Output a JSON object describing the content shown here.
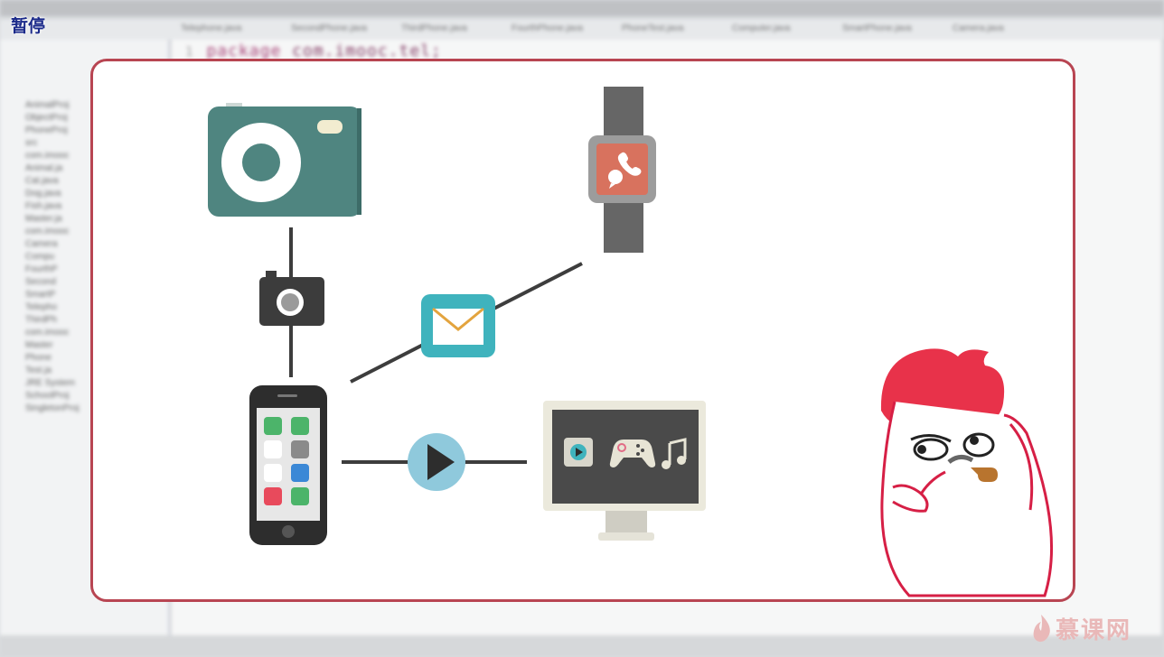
{
  "overlay": {
    "status": "暂停"
  },
  "ide": {
    "editor_tabs": [
      "Telephone.java",
      "SecondPhone.java",
      "ThirdPhone.java",
      "FourthPhone.java",
      "PhoneTest.java",
      "Computer.java",
      "SmartPhone.java",
      "Camera.java"
    ],
    "code_line_number": "1",
    "code_keyword": "package",
    "code_text": "com.imooc.tel;",
    "tree_items": [
      "AnimalProj",
      "ObjectProj",
      "PhoneProj",
      "src",
      "com.imooc",
      "Animal.ja",
      "Cat.java",
      "Dog.java",
      "Fish.java",
      "Master.ja",
      "com.imooc",
      "Camera",
      "Compu",
      "FourthP",
      "Second",
      "SmartP",
      "Telepho",
      "ThirdPh",
      "com.imooc",
      "Master",
      "Phone",
      "Test.ja",
      "JRE System",
      "SchoolProj",
      "SingletonProj"
    ]
  },
  "diagram": {
    "icons": [
      "camera-icon",
      "smartwatch-icon",
      "small-camera-icon",
      "mail-icon",
      "smartphone-icon",
      "play-icon",
      "monitor-icon"
    ],
    "monitor_icons": [
      "video-play-icon",
      "gamepad-icon",
      "music-note-icon"
    ],
    "phone_apps": [
      "phone-app",
      "messages-app",
      "photos-app",
      "camera-app",
      "video-app",
      "safari-app",
      "music-app",
      "facetime-app"
    ],
    "colors": {
      "frame": "#b84552",
      "camera": "#4f8580",
      "watch_face": "#d8725e",
      "mail": "#3fb3bd",
      "play": "#8fc9dc",
      "mascot": "#e8324a"
    }
  },
  "branding": {
    "watermark": "慕课网"
  }
}
